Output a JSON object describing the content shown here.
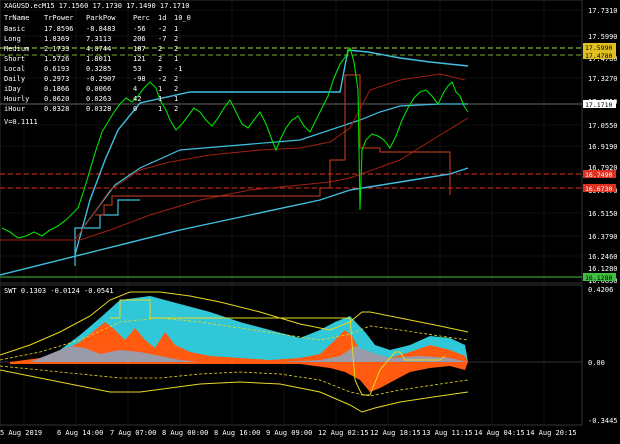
{
  "main_chart": {
    "header": "XAGUSD.ecM15  17.1560 17.1730 17.1490 17.1710",
    "price_levels": [
      "17.7310",
      "17.5990",
      "17.4780",
      "17.3270",
      "17.1710",
      "17.0550",
      "16.9190",
      "16.7920",
      "16.6470",
      "16.5150",
      "16.3790",
      "16.2460",
      "16.1280",
      "16.0850"
    ],
    "right_badges": [
      {
        "text": "17.5990",
        "bg": "#e0c020"
      },
      {
        "text": "17.4780",
        "bg": "#e0c020"
      },
      {
        "text": "17.1710",
        "bg": "#ffffff"
      },
      {
        "text": "16.7490",
        "bg": "#e03020"
      },
      {
        "text": "16.6730",
        "bg": "#e03020"
      },
      {
        "text": "16.1280",
        "bg": "#40c040"
      }
    ]
  },
  "stats_table": {
    "headers": [
      "TrName",
      "TrPower",
      "ParkPow",
      "Perc",
      "1d",
      "10_0"
    ],
    "rows": [
      [
        "Basic",
        "17.8596",
        "-8.8483",
        "-56",
        "-2",
        "1"
      ],
      [
        "Long",
        "1.8369",
        "7.3113",
        "206",
        "-7",
        "2"
      ],
      [
        "Medium",
        "2.1733",
        "4.0744",
        "187",
        "2",
        "2"
      ],
      [
        "Short",
        "1.5726",
        "1.8011",
        "121",
        "2",
        "1"
      ],
      [
        "Local",
        "0.6193",
        "0.3285",
        "53",
        "2",
        "-1"
      ],
      [
        "Daily",
        "0.2973",
        "-0.2907",
        "-98",
        "-2",
        "2"
      ],
      [
        "iDay",
        "0.1866",
        "0.0066",
        "4",
        "1",
        "2"
      ],
      [
        "Hourly",
        "0.0620",
        "0.0263",
        "42",
        "1",
        "1"
      ],
      [
        "iHour",
        "0.0328",
        "0.0328",
        "0",
        "1",
        "2"
      ]
    ],
    "footer": "V=0.1111"
  },
  "indicator": {
    "header": "SWT 0.1303 -0.0124 -0.0541",
    "levels": [
      "0.4206",
      "0.00",
      "-0.3445"
    ]
  },
  "time_axis": [
    "5 Aug 2019",
    "6 Aug 14:00",
    "7 Aug 07:00",
    "8 Aug 00:00",
    "8 Aug 16:00",
    "9 Aug 09:00",
    "12 Aug 02:15",
    "12 Aug 18:15",
    "13 Aug 11:15",
    "14 Aug 04:15",
    "14 Aug 20:15"
  ],
  "colors": {
    "price_line": "#00e000",
    "cyan_line": "#40c0e0",
    "dark_red": "#a02010",
    "dash_green": "#a0e040",
    "dash_red": "#e03020",
    "grid": "#1e1e1e",
    "area_cyan": "#30c8d8",
    "area_orange": "#ff5a10",
    "area_gray": "#9a9aa8",
    "yellow": "#e8d820"
  }
}
